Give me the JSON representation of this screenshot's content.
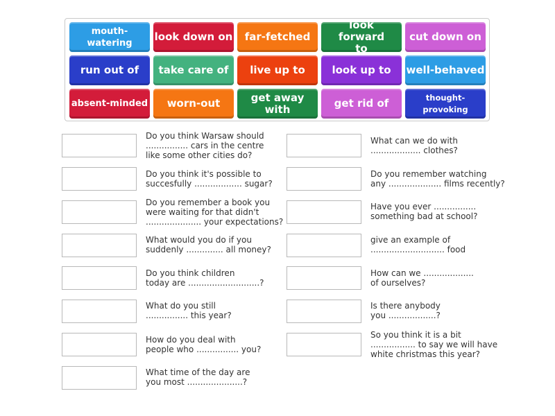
{
  "word_bank": [
    {
      "label": "mouth-watering",
      "color": "#2d9de5"
    },
    {
      "label": "look down on",
      "color": "#d31c3a"
    },
    {
      "label": "far-fetched",
      "color": "#f57613"
    },
    {
      "label": "look forward to",
      "color": "#1f8a46"
    },
    {
      "label": "cut down on",
      "color": "#cd5fd6"
    },
    {
      "label": "run out of",
      "color": "#2a3ec9"
    },
    {
      "label": "take care of",
      "color": "#43b27f"
    },
    {
      "label": "live up to",
      "color": "#ec410f"
    },
    {
      "label": "look up to",
      "color": "#8a31d8"
    },
    {
      "label": "well-behaved",
      "color": "#2d9de5"
    },
    {
      "label": "absent-minded",
      "color": "#d31c3a"
    },
    {
      "label": "worn-out",
      "color": "#f57613"
    },
    {
      "label": "get away with",
      "color": "#1f8a46"
    },
    {
      "label": "get rid of",
      "color": "#cd5fd6"
    },
    {
      "label": "thought-provoking",
      "color": "#2a3ec9"
    }
  ],
  "questions_left": [
    {
      "answer": "",
      "text": "Do you think Warsaw should\n................ cars in the centre\nlike some other cities do?"
    },
    {
      "answer": "",
      "text": "Do you think it's possible to\nsuccesfully .................. sugar?"
    },
    {
      "answer": "",
      "text": "Do you remember a book you\nwere waiting for that didn't\n..................... your expectations?"
    },
    {
      "answer": "",
      "text": "What would you do if you\nsuddenly .............. all money?"
    },
    {
      "answer": "",
      "text": "Do you think children\ntoday are ...........................?"
    },
    {
      "answer": "",
      "text": "What do you still\n................ this year?"
    },
    {
      "answer": "",
      "text": "How do you deal with\npeople who ................ you?"
    },
    {
      "answer": "",
      "text": "What time of the day are\nyou most .....................?"
    }
  ],
  "questions_right": [
    {
      "answer": "",
      "text": "What can we do with\n................... clothes?"
    },
    {
      "answer": "",
      "text": "Do you remember watching\nany .................... films recently?"
    },
    {
      "answer": "",
      "text": "Have you ever ................\nsomething bad at school?"
    },
    {
      "answer": "",
      "text": "give an example of\n............................ food"
    },
    {
      "answer": "",
      "text": "How can we ...................\nof ourselves?"
    },
    {
      "answer": "",
      "text": "Is there anybody\nyou ..................?"
    },
    {
      "answer": "",
      "text": "So you think it is a bit\n................. to say we will have\nwhite christmas this year?"
    }
  ]
}
